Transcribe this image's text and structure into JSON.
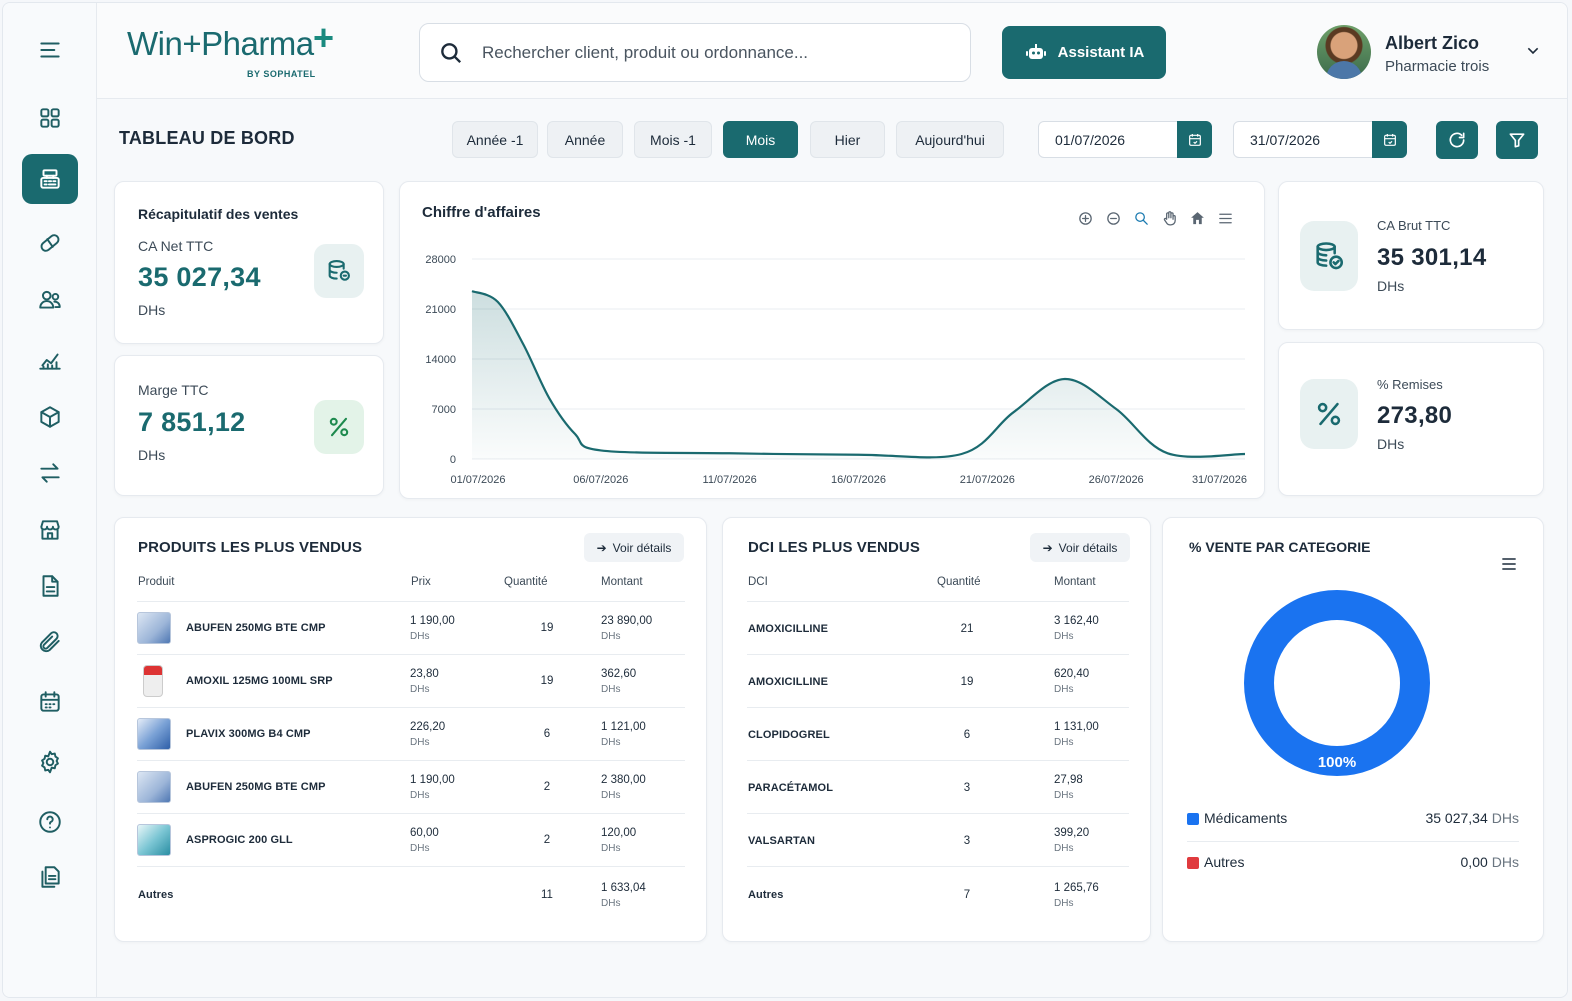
{
  "header": {
    "logo_text": "Win+Pharma",
    "logo_plus": "+",
    "logo_sub": "BY SOPHATEL",
    "search_placeholder": "Rechercher client, produit ou ordonnance...",
    "ai_button": "Assistant IA",
    "user_name": "Albert Zico",
    "user_pharmacy": "Pharmacie trois"
  },
  "sidebar": {
    "icons": [
      "menu-icon",
      "grid-icon",
      "cash-register-icon",
      "pill-icon",
      "users-icon",
      "chart-icon",
      "box-icon",
      "transfer-icon",
      "store-icon",
      "document-icon",
      "paperclip-icon",
      "calendar-icon",
      "gear-icon",
      "help-icon",
      "file-copy-icon"
    ],
    "active": "cash-register-icon"
  },
  "toolbar": {
    "title": "TABLEAU DE BORD",
    "periods": [
      "Année -1",
      "Année",
      "Mois -1",
      "Mois",
      "Hier",
      "Aujourd'hui"
    ],
    "active_period": "Mois",
    "date_from": "01/07/2026",
    "date_to": "31/07/2026"
  },
  "summary": {
    "title": "Récapitulatif des ventes",
    "net_label": "CA Net TTC",
    "net_value": "35 027,34",
    "net_unit": "DHs",
    "margin_label": "Marge TTC",
    "margin_value": "7 851,12",
    "margin_unit": "DHs"
  },
  "kpis_right": {
    "brut_label": "CA Brut TTC",
    "brut_value": "35 301,14",
    "brut_unit": "DHs",
    "remise_label": "% Remises",
    "remise_value": "273,80",
    "remise_unit": "DHs"
  },
  "chart_data": {
    "type": "area",
    "title": "Chiffre d'affaires",
    "xlabel": "",
    "ylabel": "",
    "ylim": [
      0,
      28000
    ],
    "yticks": [
      0,
      7000,
      14000,
      21000,
      28000
    ],
    "xticks": [
      "01/07/2026",
      "06/07/2026",
      "11/07/2026",
      "16/07/2026",
      "21/07/2026",
      "26/07/2026",
      "31/07/2026"
    ],
    "x": [
      "01/07/2026",
      "02/07/2026",
      "03/07/2026",
      "04/07/2026",
      "05/07/2026",
      "06/07/2026",
      "11/07/2026",
      "16/07/2026",
      "20/07/2026",
      "22/07/2026",
      "24/07/2026",
      "26/07/2026",
      "28/07/2026",
      "31/07/2026"
    ],
    "values": [
      23500,
      22000,
      16000,
      8500,
      3500,
      1200,
      800,
      600,
      700,
      6500,
      11200,
      7000,
      800,
      700
    ],
    "color": "#1a6a6f",
    "grid": true
  },
  "top_products": {
    "title": "PRODUITS LES PLUS VENDUS",
    "button": "Voir détails",
    "headers": [
      "Produit",
      "Prix",
      "Quantité",
      "Montant"
    ],
    "unit": "DHs",
    "rows": [
      {
        "name": "ABUFEN 250MG BTE CMP",
        "price": "1 190,00",
        "qty": "19",
        "amount": "23 890,00"
      },
      {
        "name": "AMOXIL 125MG 100ML SRP",
        "price": "23,80",
        "qty": "19",
        "amount": "362,60"
      },
      {
        "name": "PLAVIX 300MG B4 CMP",
        "price": "226,20",
        "qty": "6",
        "amount": "1 121,00"
      },
      {
        "name": "ABUFEN 250MG BTE CMP",
        "price": "1 190,00",
        "qty": "2",
        "amount": "2 380,00"
      },
      {
        "name": "ASPROGIC 200 GLL",
        "price": "60,00",
        "qty": "2",
        "amount": "120,00"
      }
    ],
    "others": {
      "name": "Autres",
      "qty": "11",
      "amount": "1 633,04"
    }
  },
  "top_dci": {
    "title": "DCI LES PLUS VENDUS",
    "button": "Voir détails",
    "headers": [
      "DCI",
      "Quantité",
      "Montant"
    ],
    "unit": "DHs",
    "rows": [
      {
        "name": "AMOXICILLINE",
        "qty": "21",
        "amount": "3 162,40"
      },
      {
        "name": "AMOXICILLINE",
        "qty": "19",
        "amount": "620,40"
      },
      {
        "name": "CLOPIDOGREL",
        "qty": "6",
        "amount": "1 131,00"
      },
      {
        "name": "PARACÉTAMOL",
        "qty": "3",
        "amount": "27,98"
      },
      {
        "name": "VALSARTAN",
        "qty": "3",
        "amount": "399,20"
      }
    ],
    "others": {
      "name": "Autres",
      "qty": "7",
      "amount": "1 265,76"
    }
  },
  "category": {
    "title": "% VENTE PAR CATEGORIE",
    "donut_label": "100%",
    "slices": [
      {
        "name": "Médicaments",
        "value": "35 027,34",
        "unit": "DHs",
        "percent": 100,
        "color": "#1a73f0"
      },
      {
        "name": "Autres",
        "value": "0,00",
        "unit": "DHs",
        "percent": 0,
        "color": "#e03a3e"
      }
    ]
  }
}
